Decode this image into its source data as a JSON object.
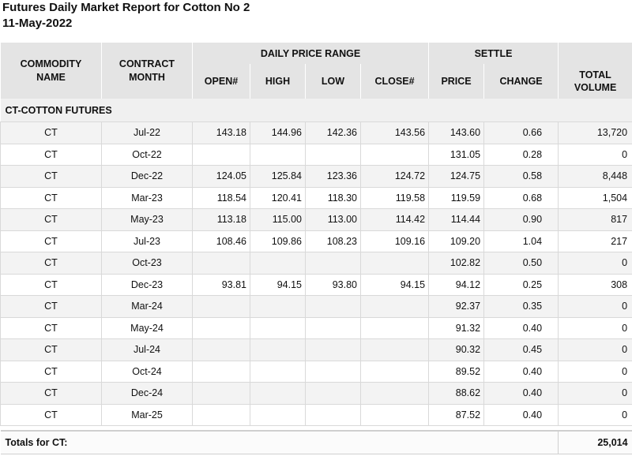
{
  "report": {
    "title": "Futures Daily Market Report for Cotton No 2",
    "date": "11-May-2022"
  },
  "headers": {
    "commodity_name": "COMMODITY NAME",
    "contract_month": "CONTRACT MONTH",
    "daily_price_range": "DAILY PRICE RANGE",
    "settle": "SETTLE",
    "open": "OPEN#",
    "high": "HIGH",
    "low": "LOW",
    "close": "CLOSE#",
    "price": "PRICE",
    "change": "CHANGE",
    "total_volume": "TOTAL VOLUME"
  },
  "section_label": "CT-COTTON FUTURES",
  "rows": [
    {
      "commodity": "CT",
      "month": "Jul-22",
      "open": "143.18",
      "high": "144.96",
      "low": "142.36",
      "close": "143.56",
      "price": "143.60",
      "change": "0.66",
      "volume": "13,720"
    },
    {
      "commodity": "CT",
      "month": "Oct-22",
      "open": "",
      "high": "",
      "low": "",
      "close": "",
      "price": "131.05",
      "change": "0.28",
      "volume": "0"
    },
    {
      "commodity": "CT",
      "month": "Dec-22",
      "open": "124.05",
      "high": "125.84",
      "low": "123.36",
      "close": "124.72",
      "price": "124.75",
      "change": "0.58",
      "volume": "8,448"
    },
    {
      "commodity": "CT",
      "month": "Mar-23",
      "open": "118.54",
      "high": "120.41",
      "low": "118.30",
      "close": "119.58",
      "price": "119.59",
      "change": "0.68",
      "volume": "1,504"
    },
    {
      "commodity": "CT",
      "month": "May-23",
      "open": "113.18",
      "high": "115.00",
      "low": "113.00",
      "close": "114.42",
      "price": "114.44",
      "change": "0.90",
      "volume": "817"
    },
    {
      "commodity": "CT",
      "month": "Jul-23",
      "open": "108.46",
      "high": "109.86",
      "low": "108.23",
      "close": "109.16",
      "price": "109.20",
      "change": "1.04",
      "volume": "217"
    },
    {
      "commodity": "CT",
      "month": "Oct-23",
      "open": "",
      "high": "",
      "low": "",
      "close": "",
      "price": "102.82",
      "change": "0.50",
      "volume": "0"
    },
    {
      "commodity": "CT",
      "month": "Dec-23",
      "open": "93.81",
      "high": "94.15",
      "low": "93.80",
      "close": "94.15",
      "price": "94.12",
      "change": "0.25",
      "volume": "308"
    },
    {
      "commodity": "CT",
      "month": "Mar-24",
      "open": "",
      "high": "",
      "low": "",
      "close": "",
      "price": "92.37",
      "change": "0.35",
      "volume": "0"
    },
    {
      "commodity": "CT",
      "month": "May-24",
      "open": "",
      "high": "",
      "low": "",
      "close": "",
      "price": "91.32",
      "change": "0.40",
      "volume": "0"
    },
    {
      "commodity": "CT",
      "month": "Jul-24",
      "open": "",
      "high": "",
      "low": "",
      "close": "",
      "price": "90.32",
      "change": "0.45",
      "volume": "0"
    },
    {
      "commodity": "CT",
      "month": "Oct-24",
      "open": "",
      "high": "",
      "low": "",
      "close": "",
      "price": "89.52",
      "change": "0.40",
      "volume": "0"
    },
    {
      "commodity": "CT",
      "month": "Dec-24",
      "open": "",
      "high": "",
      "low": "",
      "close": "",
      "price": "88.62",
      "change": "0.40",
      "volume": "0"
    },
    {
      "commodity": "CT",
      "month": "Mar-25",
      "open": "",
      "high": "",
      "low": "",
      "close": "",
      "price": "87.52",
      "change": "0.40",
      "volume": "0"
    }
  ],
  "totals": {
    "label": "Totals for CT:",
    "volume": "25,014"
  }
}
